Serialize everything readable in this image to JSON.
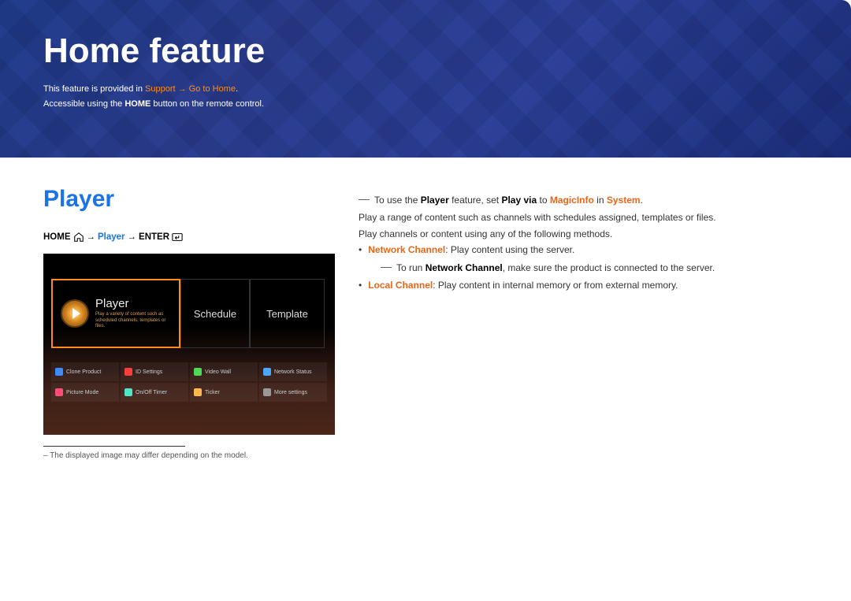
{
  "header": {
    "title": "Home feature",
    "desc1_prefix": "This feature is provided in ",
    "desc1_hl1": "Support",
    "desc1_mid": " → ",
    "desc1_hl2": "Go to Home",
    "desc1_suffix": ".",
    "desc2_prefix": "Accessible using the ",
    "desc2_bold": "HOME",
    "desc2_suffix": " button on the remote control."
  },
  "left": {
    "section_title": "Player",
    "nav_home": "HOME",
    "nav_arrow1": " → ",
    "nav_player": "Player",
    "nav_arrow2": " → ",
    "nav_enter": "ENTER",
    "footnote_prefix": "– ",
    "footnote": "The displayed image may differ depending on the model."
  },
  "screenshot": {
    "player_title": "Player",
    "player_sub": "Play a variety of content such as scheduled channels, templates or files.",
    "schedule": "Schedule",
    "template": "Template",
    "grid": [
      [
        "Clone Product",
        "ID Settings",
        "Video Wall",
        "Network Status"
      ],
      [
        "Picture Mode",
        "On/Off Timer",
        "Ticker",
        "More settings"
      ]
    ]
  },
  "right": {
    "note1_prefix": "To use the ",
    "note1_b1": "Player",
    "note1_mid1": " feature, set ",
    "note1_b2": "Play via",
    "note1_mid2": " to ",
    "note1_b3": "MagicInfo",
    "note1_mid3": " in ",
    "note1_b4": "System",
    "note1_suffix": ".",
    "p1": "Play a range of content such as channels with schedules assigned, templates or files.",
    "p2": "Play channels or content using any of the following methods.",
    "b1_label": "Network Channel",
    "b1_text": ": Play content using the server.",
    "b1_note_pre": "To run ",
    "b1_note_bold": "Network Channel",
    "b1_note_post": ", make sure the product is connected to the server.",
    "b2_label": "Local Channel",
    "b2_text": ": Play content in internal memory or from external memory."
  },
  "icon_colors": {
    "clone": "#3d8bff",
    "id": "#ff3d3d",
    "video": "#4dd956",
    "network": "#4da6ff",
    "picture": "#ff4d7a",
    "timer": "#4de6c7",
    "ticker": "#ffb84d",
    "more": "#999"
  }
}
